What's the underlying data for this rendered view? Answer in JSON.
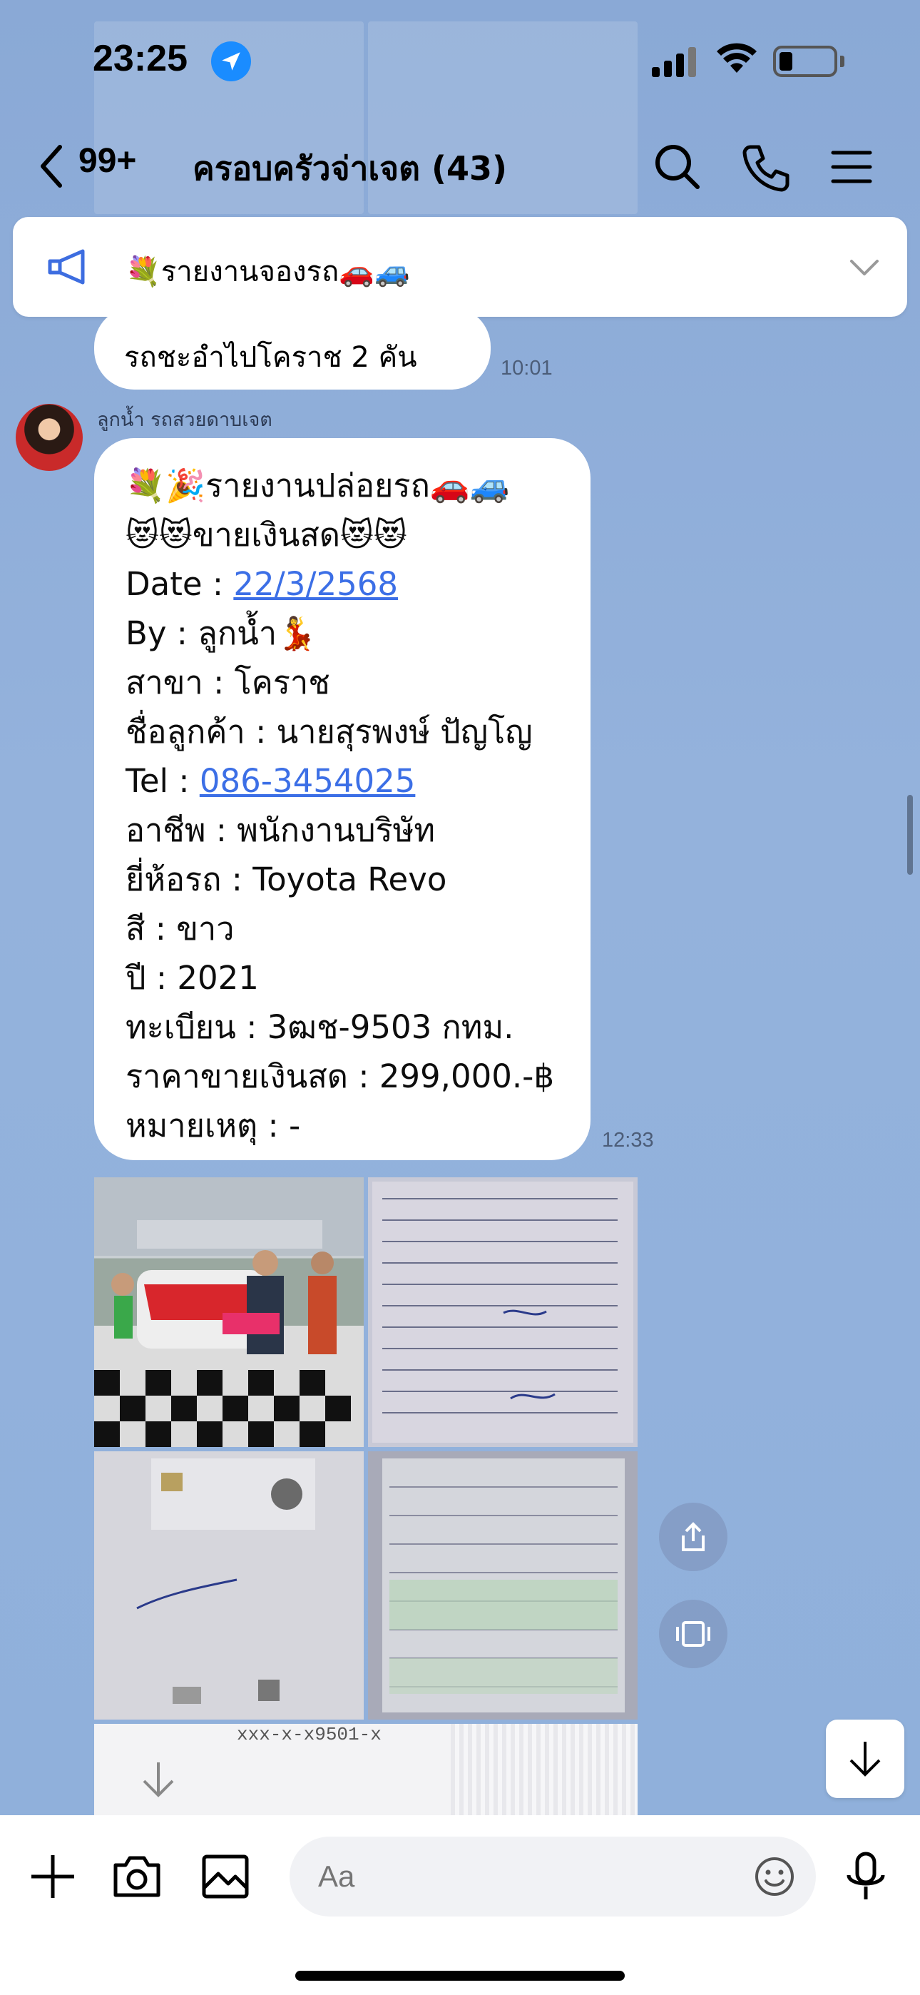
{
  "status_bar": {
    "time": "23:25"
  },
  "header": {
    "unread_count": "99+",
    "group_title": "ครอบครัวจ่าเจต (43)"
  },
  "announcement": {
    "text": "💐รายงานจองรถ🚗🚙"
  },
  "messages": [
    {
      "text": "รถชะอำไปโคราช 2 คัน",
      "time": "10:01"
    },
    {
      "sender": "ลูกน้ำ รถสวยดาบเจต",
      "time": "12:33",
      "lines": {
        "l1": "💐🎉รายงานปล่อยรถ🚗🚙",
        "l2": "😻😻ขายเงินสด😻😻",
        "date_label": "Date : ",
        "date_value": "22/3/2568",
        "by": "By : ลูกน้ำ💃",
        "branch": "สาขา : โคราช",
        "customer": "ชื่อลูกค้า : นายสุรพงษ์ ปัญโญ",
        "tel_label": "Tel : ",
        "tel_value": "086-3454025",
        "occupation": "อาชีพ : พนักงานบริษัท",
        "brand": "ยี่ห้อรถ : Toyota Revo",
        "color": "สี : ขาว",
        "year": "ปี : 2021",
        "plate": "ทะเบียน : 3ฒช-9503 กทม.",
        "price": "ราคาขายเงินสด : 299,000.-฿",
        "note": "หมายเหตุ : -"
      }
    }
  ],
  "photo_strip_text": "xxx-x-x9501-x",
  "input": {
    "placeholder": "Aa"
  },
  "colors": {
    "link": "#3c6fe6",
    "background": "#8fadd8",
    "location": "#1a8cff"
  }
}
